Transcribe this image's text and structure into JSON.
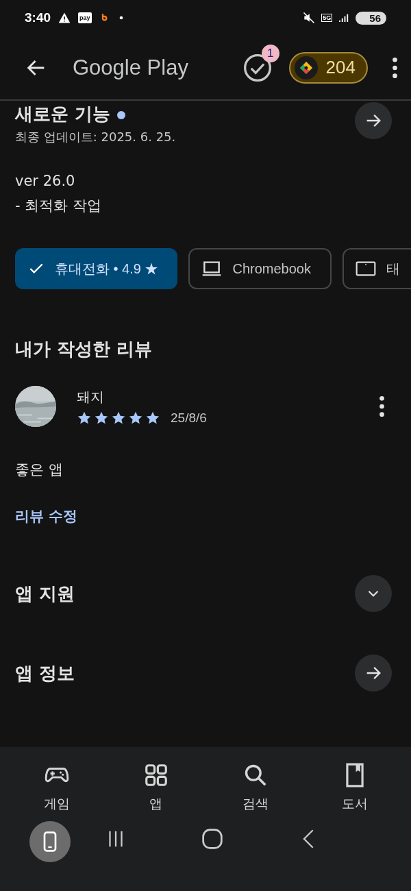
{
  "status_bar": {
    "time": "3:40",
    "pay_badge": "pay",
    "network": "5G",
    "battery": "56"
  },
  "header": {
    "title": "Google Play",
    "badge": "1",
    "points": "204"
  },
  "whats_new": {
    "title": "새로운 기능",
    "updated": "최종 업데이트: 2025. 6. 25.",
    "version": "ver 26.0",
    "notes": "- 최적화 작업"
  },
  "device_chips": [
    {
      "kind": "phone",
      "label": "휴대전화 • 4.9 ★",
      "selected": true
    },
    {
      "kind": "laptop",
      "label": "Chromebook",
      "selected": false
    },
    {
      "kind": "tablet",
      "label": "태",
      "selected": false
    }
  ],
  "my_review": {
    "title": "내가 작성한 리뷰",
    "author": "돼지",
    "stars": 5,
    "date": "25/8/6",
    "text": "좋은 앱",
    "edit_link": "리뷰 수정"
  },
  "sections": [
    {
      "title": "앱 지원",
      "kind": "expand"
    },
    {
      "title": "앱 정보",
      "kind": "open"
    }
  ],
  "bottom_nav": [
    {
      "kind": "games",
      "label": "게임",
      "selected": false
    },
    {
      "kind": "apps",
      "label": "앱",
      "selected": false
    },
    {
      "kind": "search",
      "label": "검색",
      "selected": false
    },
    {
      "kind": "books",
      "label": "도서",
      "selected": false
    }
  ]
}
